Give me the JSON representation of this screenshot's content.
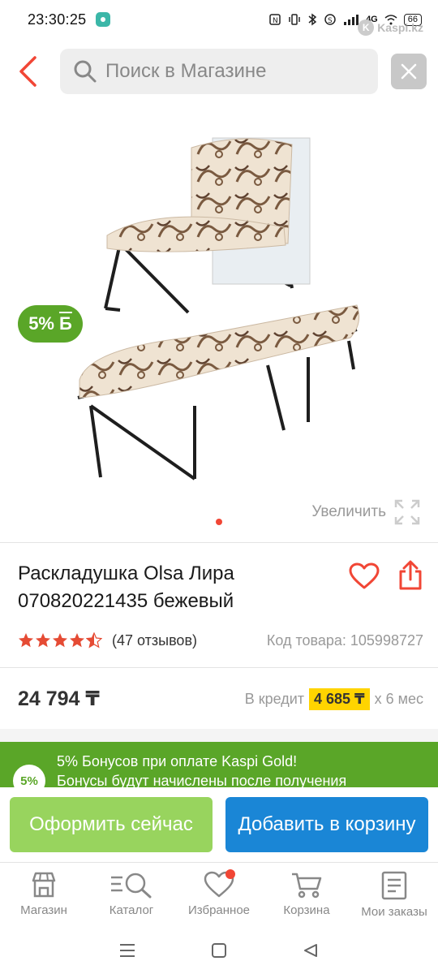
{
  "status_bar": {
    "time": "23:30:25",
    "network": "4G",
    "battery": "66"
  },
  "watermark": {
    "text": "Kaspi.kz"
  },
  "search": {
    "placeholder": "Поиск в Магазине"
  },
  "gallery": {
    "bonus_percent": "5%",
    "bonus_currency": "Б",
    "zoom_label": "Увеличить"
  },
  "product": {
    "title_line1": "Раскладушка Olsa Лира",
    "title_line2": "070820221435 бежевый",
    "rating": 4.5,
    "reviews": "(47 отзывов)",
    "sku": "Код товара: 105998727",
    "price": "24 794 ₸",
    "credit_prefix": "В кредит",
    "credit_amount": "4 685 ₸",
    "credit_suffix": "х 6 мес"
  },
  "bonus_banner": {
    "badge": "5%",
    "line1": "5% Бонусов при оплате Kaspi Gold!",
    "line2": "Бонусы будут начислены после получения"
  },
  "actions": {
    "buy_now": "Оформить сейчас",
    "add_to_cart": "Добавить в корзину"
  },
  "tabs": [
    {
      "label": "Магазин"
    },
    {
      "label": "Каталог"
    },
    {
      "label": "Избранное"
    },
    {
      "label": "Корзина"
    },
    {
      "label": "Мои заказы"
    }
  ],
  "colors": {
    "accent_red": "#f14635",
    "bonus_green": "#5aa628",
    "buy_green": "#98d45e",
    "cart_blue": "#1a86d6",
    "credit_yellow": "#ffd400"
  }
}
